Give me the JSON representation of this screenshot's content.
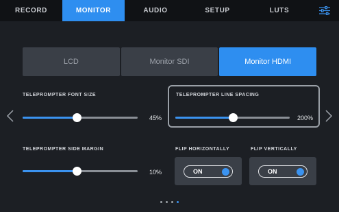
{
  "tabs": [
    {
      "label": "RECORD",
      "active": false
    },
    {
      "label": "MONITOR",
      "active": true
    },
    {
      "label": "AUDIO",
      "active": false
    },
    {
      "label": "SETUP",
      "active": false
    },
    {
      "label": "LUTS",
      "active": false
    }
  ],
  "menu_icon": "sliders-icon",
  "outputs": [
    {
      "label": "LCD",
      "active": false
    },
    {
      "label": "Monitor SDI",
      "active": false
    },
    {
      "label": "Monitor HDMI",
      "active": true
    }
  ],
  "font_size": {
    "label": "TELEPROMPTER FONT SIZE",
    "value": "45%",
    "level": 0.47
  },
  "line_spacing": {
    "label": "TELEPROMPTER LINE SPACING",
    "value": "200%",
    "level": 0.5
  },
  "side_margin": {
    "label": "TELEPROMPTER SIDE MARGIN",
    "value": "10%",
    "level": 0.47
  },
  "flip_horizontal": {
    "label": "FLIP HORIZONTALLY",
    "state": "ON"
  },
  "flip_vertical": {
    "label": "FLIP VERTICALLY",
    "state": "ON"
  },
  "pagination": {
    "total": 4,
    "current": 4
  },
  "colors": {
    "accent": "#2e8ef0",
    "background": "#1c1f24",
    "tabbar": "#101215"
  }
}
